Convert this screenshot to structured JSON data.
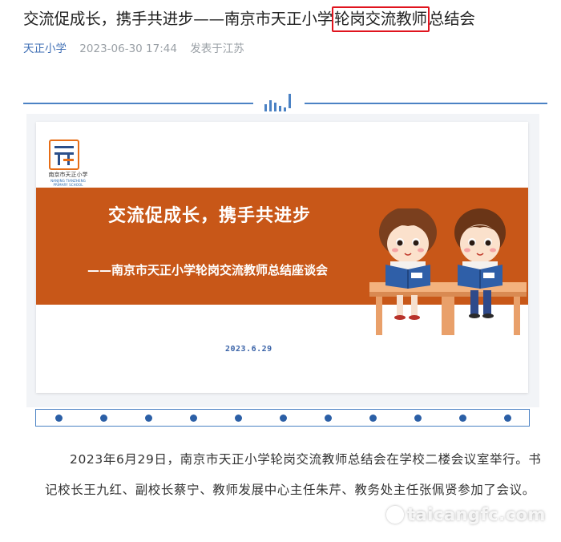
{
  "article": {
    "title_before": "交流促成长，携手共进步——南京市天正小学",
    "title_highlight": "轮岗交流教师",
    "title_after": "总结会",
    "account": "天正小学",
    "datetime": "2023-06-30 17:44",
    "location": "发表于江苏"
  },
  "slide": {
    "logo_name": "南京市天正小学",
    "logo_en_1": "NANJING TIANZHENG",
    "logo_en_2": "PRIMARY SCHOOL",
    "headline": "交流促成长，携手共进步",
    "subtitle": "——南京市天正小学轮岗交流教师总结座谈会",
    "date": "2023.6.29"
  },
  "body": {
    "paragraph": "2023年6月29日，南京市天正小学轮岗交流教师总结会在学校二楼会议室举行。书记校长王九红、副校长蔡宁、教师发展中心主任朱芹、教务处主任张佩贤参加了会议。"
  },
  "watermark": {
    "text": "taicangfc.com"
  },
  "colors": {
    "accent": "#4b82c4",
    "slide_band": "#c85718",
    "highlight_box": "#e0141e"
  }
}
